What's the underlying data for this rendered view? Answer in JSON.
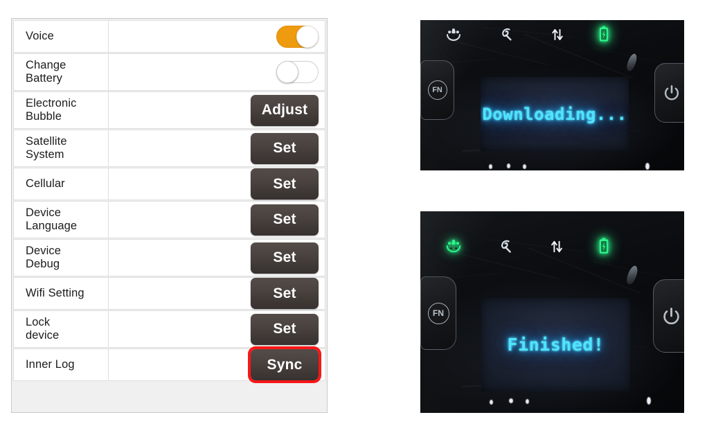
{
  "settings": {
    "rows": [
      {
        "label_lines": [
          "Voice"
        ],
        "control": "toggle",
        "state": "on",
        "lines": 1
      },
      {
        "label_lines": [
          "Change",
          "Battery"
        ],
        "control": "toggle",
        "state": "off",
        "lines": 2
      },
      {
        "label_lines": [
          "Electronic",
          "Bubble"
        ],
        "control": "button",
        "button_label": "Adjust",
        "highlighted": false,
        "lines": 2
      },
      {
        "label_lines": [
          "Satellite",
          "System"
        ],
        "control": "button",
        "button_label": "Set",
        "highlighted": false,
        "lines": 2
      },
      {
        "label_lines": [
          "Cellular"
        ],
        "control": "button",
        "button_label": "Set",
        "highlighted": false,
        "lines": 1
      },
      {
        "label_lines": [
          "Device",
          "Language"
        ],
        "control": "button",
        "button_label": "Set",
        "highlighted": false,
        "lines": 2
      },
      {
        "label_lines": [
          "Device",
          "Debug"
        ],
        "control": "button",
        "button_label": "Set",
        "highlighted": false,
        "lines": 2
      },
      {
        "label_lines": [
          "Wifi Setting"
        ],
        "control": "button",
        "button_label": "Set",
        "highlighted": false,
        "lines": 1
      },
      {
        "label_lines": [
          "Lock",
          "device"
        ],
        "control": "button",
        "button_label": "Set",
        "highlighted": false,
        "lines": 2
      },
      {
        "label_lines": [
          "Inner Log"
        ],
        "control": "button",
        "button_label": "Sync",
        "highlighted": true,
        "lines": 1
      }
    ],
    "colors": {
      "toggle_on": "#ef9b0f",
      "button_dark": "#4a433f",
      "highlight_outline": "#fb1616",
      "row_border": "#dedede",
      "panel_background": "#f0f0f0"
    }
  },
  "photos": [
    {
      "name": "downloading",
      "lcd_text": "Downloading...",
      "lcd_text_color": "#4fe4ff",
      "leds": [
        {
          "name": "satellite-led",
          "lit": false,
          "color": "#d8dee6"
        },
        {
          "name": "data-storage-led",
          "lit": false,
          "color": "#d8dee6"
        },
        {
          "name": "data-transfer-led",
          "lit": false,
          "color": "#eef2f6"
        },
        {
          "name": "battery-led",
          "lit": true,
          "color": "#2bf58a"
        }
      ],
      "keys": [
        {
          "name": "fn-key",
          "glyph": "FN"
        },
        {
          "name": "power-key",
          "glyph": "power"
        }
      ]
    },
    {
      "name": "finished",
      "lcd_text": "Finished!",
      "lcd_text_color": "#4fe4ff",
      "leds": [
        {
          "name": "satellite-led",
          "lit": true,
          "color": "#2bf58a"
        },
        {
          "name": "data-storage-led",
          "lit": false,
          "color": "#d8dee6"
        },
        {
          "name": "data-transfer-led",
          "lit": false,
          "color": "#eef2f6"
        },
        {
          "name": "battery-led",
          "lit": true,
          "color": "#2bf58a"
        }
      ],
      "keys": [
        {
          "name": "fn-key",
          "glyph": "FN"
        },
        {
          "name": "power-key",
          "glyph": "power"
        }
      ]
    }
  ]
}
